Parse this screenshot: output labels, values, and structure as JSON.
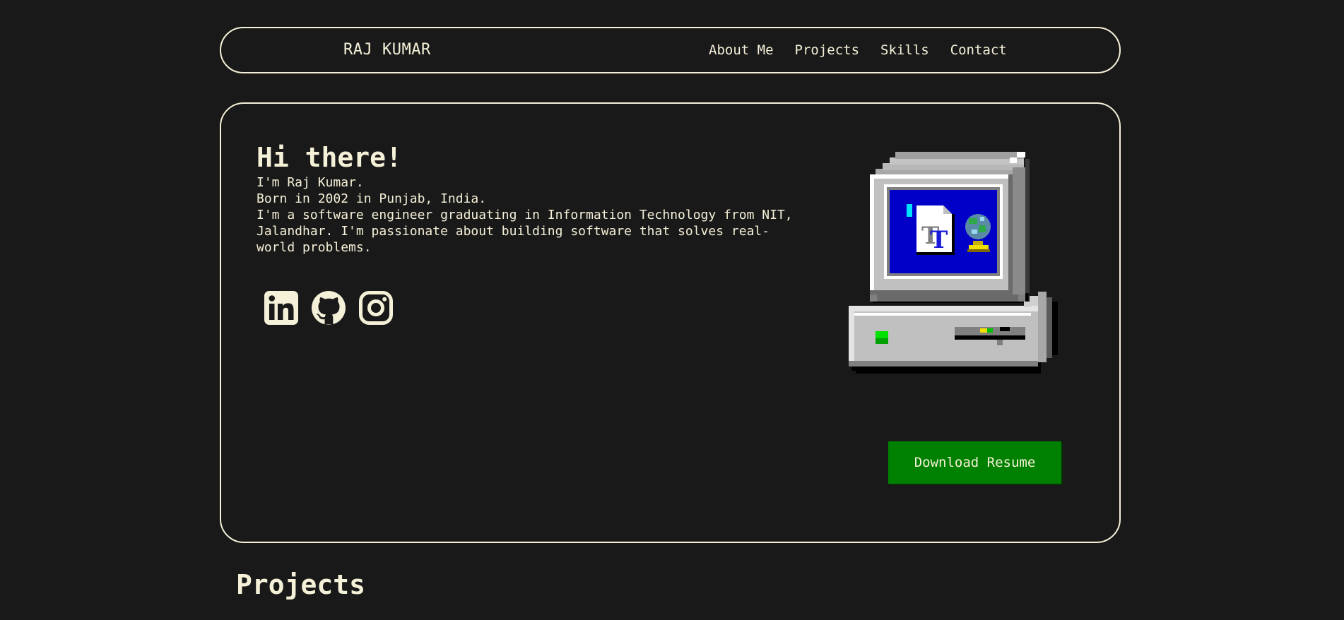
{
  "nav": {
    "brand": "RAJ KUMAR",
    "links": [
      "About Me",
      "Projects",
      "Skills",
      "Contact"
    ]
  },
  "hero": {
    "title": "Hi there!",
    "lines": [
      "I'm Raj Kumar.",
      "Born in 2002 in Punjab, India.",
      "I'm a software engineer graduating in Information Technology from NIT, Jalandhar. I'm passionate about building software that solves real-world problems."
    ],
    "socials": [
      {
        "name": "linkedin-icon"
      },
      {
        "name": "github-icon"
      },
      {
        "name": "instagram-icon"
      }
    ],
    "illustration": "retro-computer-icon",
    "resume_label": "Download Resume"
  },
  "projects": {
    "heading": "Projects"
  },
  "colors": {
    "background": "#191919",
    "foreground": "#f5f0d8",
    "button": "#008000",
    "screen": "#0000c8"
  }
}
